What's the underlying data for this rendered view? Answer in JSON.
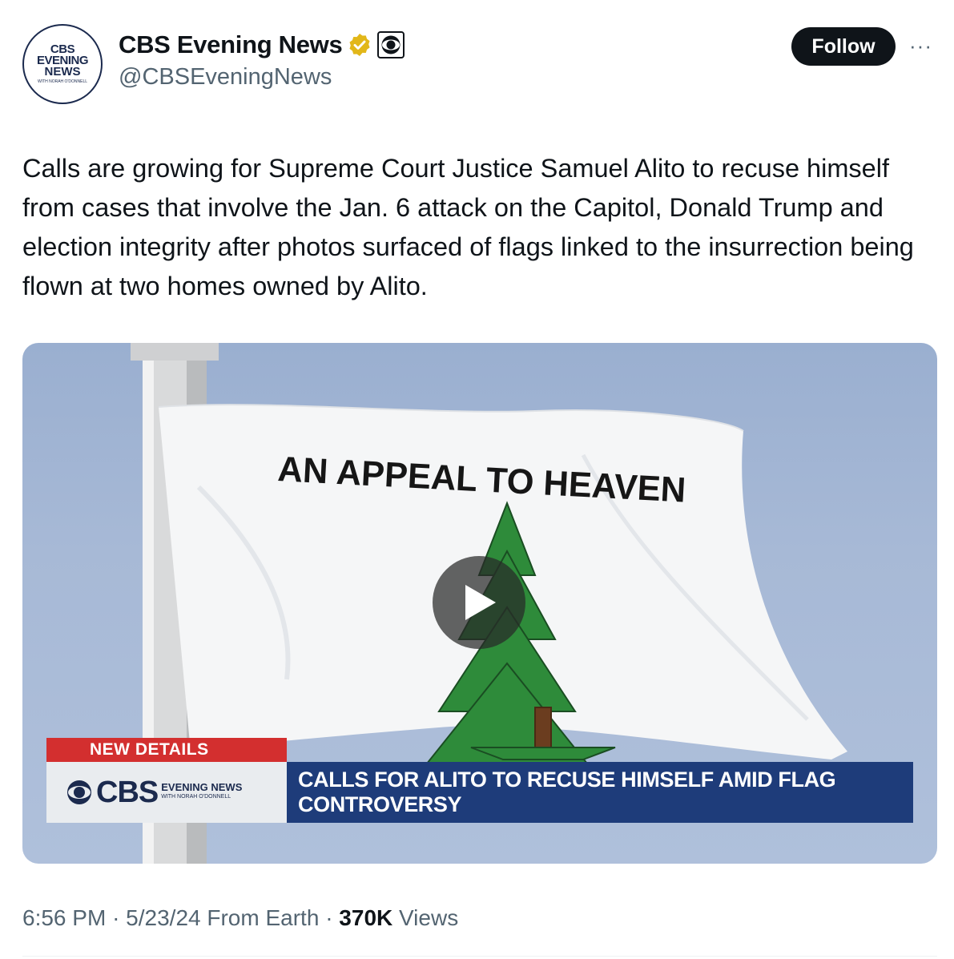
{
  "author": {
    "display_name": "CBS Evening News",
    "handle": "@CBSEveningNews",
    "avatar_lines": [
      "CBS",
      "EVENING",
      "NEWS",
      "WITH NORAH O'DONNELL"
    ],
    "verified_color": "#e2b719"
  },
  "actions": {
    "follow_label": "Follow",
    "more_label": "···"
  },
  "tweet": {
    "text": "Calls are growing for Supreme Court Justice Samuel Alito to recuse himself from cases that involve the Jan. 6 attack on the Capitol, Donald Trump and election integrity after photos surfaced of flags linked to the insurrection being flown at two homes owned by Alito."
  },
  "media": {
    "flag_text": "AN APPEAL TO HEAVEN",
    "lower_third_label": "NEW DETAILS",
    "lower_third_logo": "CBS",
    "lower_third_logo_sub1": "EVENING NEWS",
    "lower_third_logo_sub2": "WITH NORAH O'DONNELL",
    "lower_third_headline": "CALLS FOR ALITO TO RECUSE HIMSELF AMID FLAG CONTROVERSY",
    "colors": {
      "sky": "#a7b9d6",
      "tree": "#2e8b3a",
      "label_red": "#d32f2f",
      "headline_blue": "#1e3c7a"
    }
  },
  "meta": {
    "time": "6:56 PM",
    "date": "5/23/24",
    "source": "From Earth",
    "views_count": "370K",
    "views_label": "Views"
  }
}
